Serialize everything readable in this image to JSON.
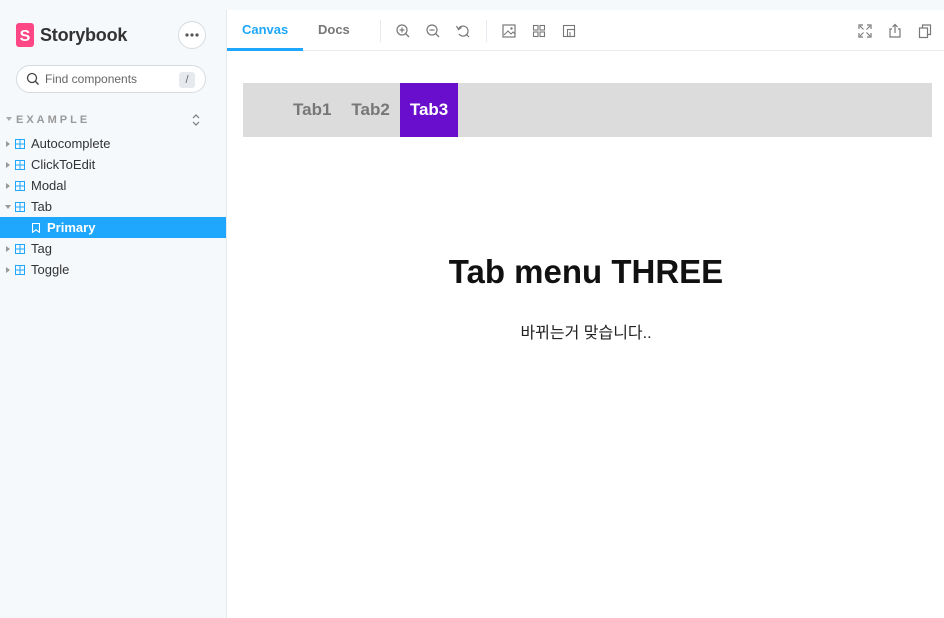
{
  "app": {
    "name": "Storybook",
    "brand_color": "#ff4785",
    "accent_color": "#1ea7fd"
  },
  "sidebar": {
    "menu_icon": "ellipsis-icon",
    "search": {
      "placeholder": "Find components",
      "shortcut": "/"
    },
    "section": {
      "title": "EXAMPLE"
    },
    "items": [
      {
        "label": "Autocomplete",
        "expanded": false
      },
      {
        "label": "ClickToEdit",
        "expanded": false
      },
      {
        "label": "Modal",
        "expanded": false
      },
      {
        "label": "Tab",
        "expanded": true,
        "children": [
          {
            "label": "Primary",
            "selected": true
          }
        ]
      },
      {
        "label": "Tag",
        "expanded": false
      },
      {
        "label": "Toggle",
        "expanded": false
      }
    ]
  },
  "toolbar": {
    "tabs": [
      {
        "label": "Canvas",
        "active": true
      },
      {
        "label": "Docs",
        "active": false
      }
    ],
    "tools": [
      "zoom-in-icon",
      "zoom-out-icon",
      "zoom-reset-icon",
      "background-icon",
      "grid-icon",
      "outline-icon"
    ],
    "actions": [
      "fullscreen-icon",
      "share-icon",
      "copy-icon"
    ]
  },
  "preview": {
    "tabs": [
      {
        "label": "Tab1",
        "active": false
      },
      {
        "label": "Tab2",
        "active": false
      },
      {
        "label": "Tab3",
        "active": true
      }
    ],
    "active_tab_color": "#6a0ecd",
    "title": "Tab menu THREE",
    "description": "바뀌는거 맞습니다.."
  }
}
